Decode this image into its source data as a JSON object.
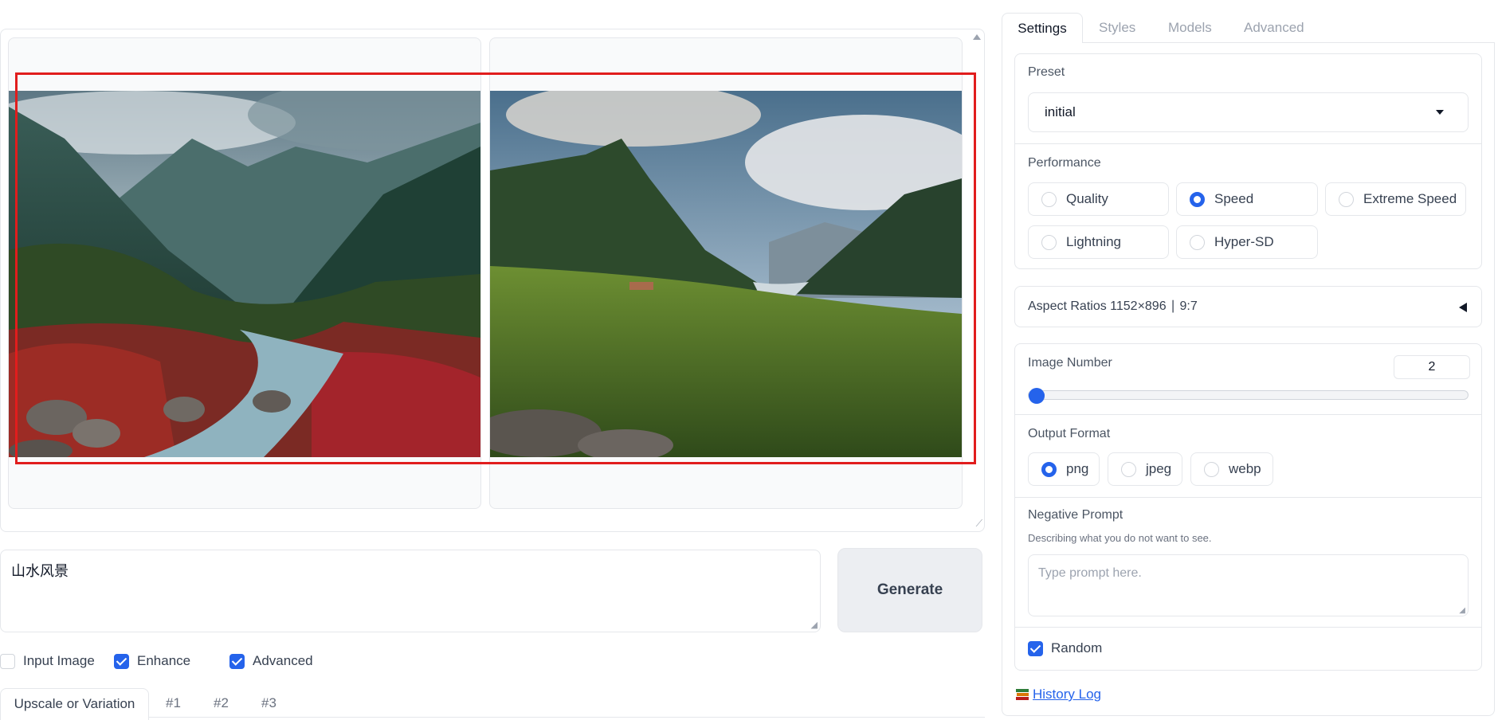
{
  "prompt": {
    "value": "山水风景"
  },
  "generate": {
    "label": "Generate"
  },
  "options": {
    "input_image": {
      "label": "Input Image",
      "checked": false
    },
    "enhance": {
      "label": "Enhance",
      "checked": true
    },
    "advanced": {
      "label": "Advanced",
      "checked": true
    }
  },
  "bottom_tabs": [
    "Upscale or Variation",
    "#1",
    "#2",
    "#3"
  ],
  "right_tabs": [
    "Settings",
    "Styles",
    "Models",
    "Advanced"
  ],
  "preset": {
    "label": "Preset",
    "value": "initial"
  },
  "performance": {
    "label": "Performance",
    "options": [
      "Quality",
      "Speed",
      "Extreme Speed",
      "Lightning",
      "Hyper-SD"
    ],
    "selected": "Speed"
  },
  "aspect": {
    "label": "Aspect Ratios 1152×896 ∣ 9:7"
  },
  "image_number": {
    "label": "Image Number",
    "value": "2"
  },
  "output_format": {
    "label": "Output Format",
    "options": [
      "png",
      "jpeg",
      "webp"
    ],
    "selected": "png"
  },
  "negative_prompt": {
    "label": "Negative Prompt",
    "hint": "Describing what you do not want to see.",
    "placeholder": "Type prompt here."
  },
  "random": {
    "label": "Random",
    "checked": true
  },
  "history": {
    "label": "History Log"
  },
  "colors": {
    "accent": "#2563eb",
    "selection": "#e11d1d"
  },
  "icons": {
    "history": "books-icon",
    "dropdown": "chevron-down-icon",
    "collapse": "triangle-left-icon"
  }
}
